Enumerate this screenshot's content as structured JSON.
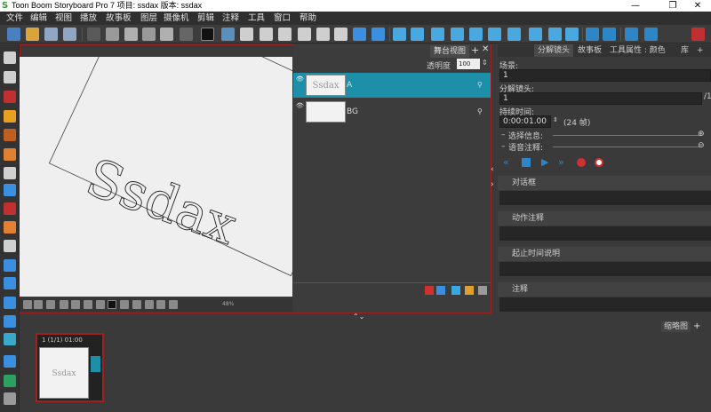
{
  "title_bar": {
    "app_title": "Toon Boom Storyboard Pro 7 项目:  ssdax 版本: ssdax",
    "minimize": "—",
    "restore": "❐",
    "close": "✕"
  },
  "menu": [
    "文件",
    "编辑",
    "视图",
    "播放",
    "故事板",
    "图层",
    "摄像机",
    "剪辑",
    "注释",
    "工具",
    "窗口",
    "帮助"
  ],
  "stage": {
    "tab_label": "舞台视图",
    "opacity_label": "透明度",
    "opacity_value": "100",
    "canvas_text": "Ssdax",
    "zoom": "48%"
  },
  "layers": [
    {
      "name": "A",
      "thumb_text": "Ssdax",
      "selected": true
    },
    {
      "name": "BG",
      "thumb_text": "",
      "selected": false
    }
  ],
  "right_panel": {
    "tabs": [
      "分解镜头",
      "故事板",
      "工具属性 : 颜色",
      "库"
    ],
    "scene_label": "场景:",
    "scene_value": "1",
    "panel_label": "分解镜头:",
    "panel_value": "1",
    "panel_total": "/1",
    "duration_label": "持续时间:",
    "duration_value": "0:00:01.00",
    "duration_frames": "(24 帧)",
    "selection_info": "选择信息:",
    "voice_note": "语音注释:",
    "sections": [
      "对话框",
      "动作注释",
      "起止时间说明",
      "注释"
    ]
  },
  "thumbnails": {
    "header_label": "缩略图",
    "panel_info": "1 (1/1) 01:00",
    "panel_text": "Ssdax"
  },
  "colors": {
    "accent": "#1e8fa8",
    "selection_border": "#a02020"
  }
}
